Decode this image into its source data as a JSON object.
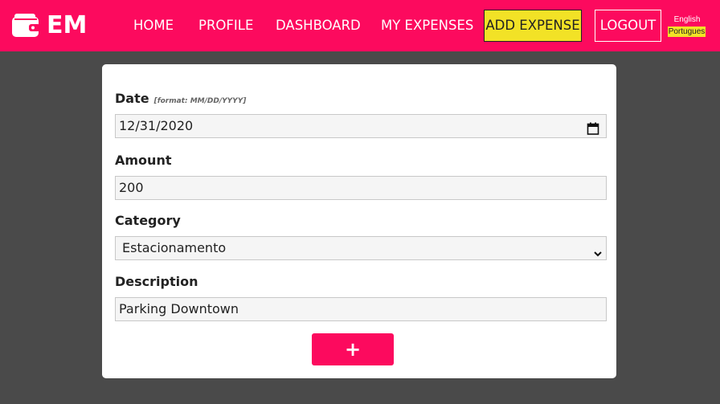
{
  "brand": {
    "text": "EM",
    "icon": "wallet-icon"
  },
  "nav": {
    "home": "HOME",
    "profile": "PROFILE",
    "dashboard": "DASHBOARD",
    "my_expenses": "MY EXPENSES",
    "add_expense": "ADD EXPENSE",
    "logout": "LOGOUT"
  },
  "languages": {
    "english": "English",
    "portuguese": "Portugues"
  },
  "form": {
    "date_label": "Date",
    "date_hint": "[format: MM/DD/YYYY]",
    "date_value": "12/31/2020",
    "amount_label": "Amount",
    "amount_value": "200",
    "category_label": "Category",
    "category_value": "Estacionamento",
    "description_label": "Description",
    "description_value": "Parking Downtown",
    "submit_label": "+"
  },
  "colors": {
    "brand": "#fc0a5e",
    "accent": "#f2e226",
    "background": "#4a4a4a",
    "card": "#ffffff"
  }
}
